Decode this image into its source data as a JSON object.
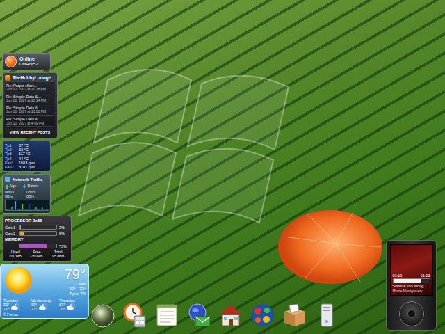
{
  "messenger": {
    "status": "Online",
    "user": "DMHolt57"
  },
  "forum": {
    "title": "TheHobbyLounge",
    "posts": [
      {
        "title": "Re: Parp's effort...",
        "date": "Jun 10, 2007 at 11:28 PM"
      },
      {
        "title": "Re: Simple Data &...",
        "date": "Jun 10, 2007 at 10:14 PM"
      },
      {
        "title": "Re: Simple Data &...",
        "date": "Jun 10, 2007 at 10:00 PM"
      },
      {
        "title": "Re: Simple Data &...",
        "date": "Jun 10, 2007 at 4:49 PM"
      }
    ],
    "footer": "VIEW RECENT POSTS"
  },
  "sensors": [
    {
      "label": "Tp1",
      "value": "57 °C"
    },
    {
      "label": "Tp2",
      "value": "53 °C"
    },
    {
      "label": "Tp3",
      "value": "117 °C"
    },
    {
      "label": "Tp4",
      "value": "44 °C"
    },
    {
      "label": "Fan1",
      "value": "1683 rpm"
    },
    {
      "label": "Fan2",
      "value": "3181 rpm"
    }
  ],
  "network": {
    "title": "Network Traffic",
    "up": {
      "label": "Up:",
      "readings": [
        "0bit/s",
        "0B/s"
      ]
    },
    "down": {
      "label": "Down:",
      "readings": [
        "0bit/s",
        "0B/s"
      ]
    },
    "graph": {
      "up": [
        0,
        0,
        1,
        0,
        0,
        0,
        2,
        0,
        0,
        0,
        0,
        1,
        0,
        0,
        0,
        0
      ],
      "down": [
        0,
        0,
        0,
        3,
        0,
        0,
        0,
        0,
        2,
        0,
        0,
        0,
        0,
        1,
        0,
        0
      ]
    }
  },
  "processor": {
    "title": "PROCESSOR 2x86",
    "cores": [
      {
        "label": "Core1",
        "level": 0.02,
        "reading": "2%"
      },
      {
        "label": "Core2",
        "level": 0.09,
        "reading": "9%"
      }
    ]
  },
  "memory": {
    "title": "MEMORY",
    "level": 0.73,
    "reading": "73%",
    "stats": [
      {
        "label": "Used",
        "value": "697MB"
      },
      {
        "label": "Free",
        "value": "260MB"
      },
      {
        "label": "Total",
        "value": "957MB"
      }
    ]
  },
  "weather": {
    "temp": "79°",
    "condition": "Clear",
    "range": "90° - 72°",
    "city": "Tyler, TX",
    "forecast": [
      {
        "day": "Tuesday",
        "high": "90°",
        "low": "71°"
      },
      {
        "day": "Wednesday",
        "high": "90°",
        "low": "72°"
      },
      {
        "day": "Thursday",
        "high": "87°",
        "low": "70°"
      }
    ],
    "credit": "© Foreca"
  },
  "dock": {
    "items": [
      {
        "kind": "orb"
      },
      {
        "kind": "clock"
      },
      {
        "kind": "notepad"
      },
      {
        "kind": "mail"
      },
      {
        "kind": "house"
      },
      {
        "kind": "ball"
      },
      {
        "kind": "box"
      },
      {
        "kind": "tower"
      }
    ]
  },
  "player": {
    "elapsed": "03:10",
    "remaining": "-01:03",
    "title": "Sounds Too Wong",
    "artist": "Monte Montgomery",
    "level": 0.75
  }
}
